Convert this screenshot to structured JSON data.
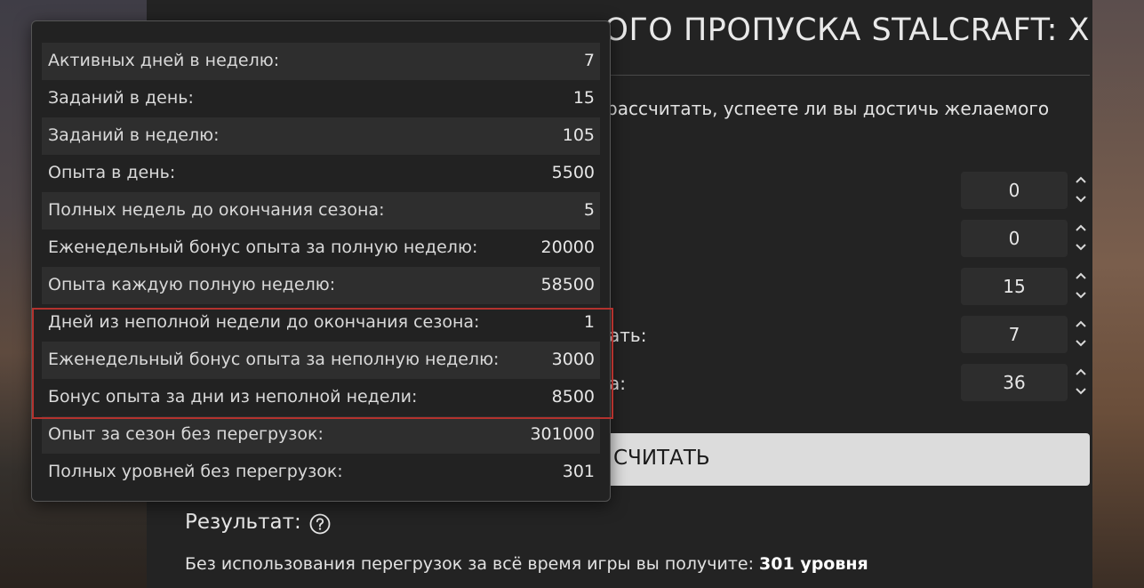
{
  "header": {
    "title": "ОГО ПРОПУСКА STALCRAFT: X"
  },
  "intro": {
    "text": "рассчитать, успеете ли вы достичь желаемого"
  },
  "form": {
    "fields": [
      {
        "label": "",
        "value": "0"
      },
      {
        "label": "",
        "value": "0"
      },
      {
        "label": "",
        "value": "15"
      },
      {
        "label": "ать:",
        "value": "7"
      },
      {
        "label": "а:",
        "value": "36"
      }
    ],
    "spinner_up_icon": "chevron-up-icon",
    "spinner_down_icon": "chevron-down-icon"
  },
  "calc_button": {
    "label": "СЧИТАТЬ"
  },
  "result": {
    "heading": "Результат:",
    "help_icon": "question-circle-icon",
    "text_prefix": "Без использования перегрузок за всё время игры вы получите:",
    "text_bold": "301 уровня"
  },
  "popup": {
    "rows": [
      {
        "label": "Активных дней в неделю:",
        "value": "7"
      },
      {
        "label": "Заданий в день:",
        "value": "15"
      },
      {
        "label": "Заданий в неделю:",
        "value": "105"
      },
      {
        "label": "Опыта в день:",
        "value": "5500"
      },
      {
        "label": "Полных недель до окончания сезона:",
        "value": "5"
      },
      {
        "label": "Еженедельный бонус опыта за полную неделю:",
        "value": "20000"
      },
      {
        "label": "Опыта каждую полную неделю:",
        "value": "58500"
      },
      {
        "label": "Дней из неполной недели до окончания сезона:",
        "value": "1"
      },
      {
        "label": "Еженедельный бонус опыта за неполную неделю:",
        "value": "3000"
      },
      {
        "label": "Бонус опыта за дни из неполной недели:",
        "value": "8500"
      },
      {
        "label": "Опыт за сезон без перегрузок:",
        "value": "301000"
      },
      {
        "label": "Полных уровней без перегрузок:",
        "value": "301"
      }
    ]
  },
  "colors": {
    "panel": "#232323",
    "input": "#2d2d2d",
    "button": "#dcdcdc",
    "highlight": "#b3322e"
  }
}
